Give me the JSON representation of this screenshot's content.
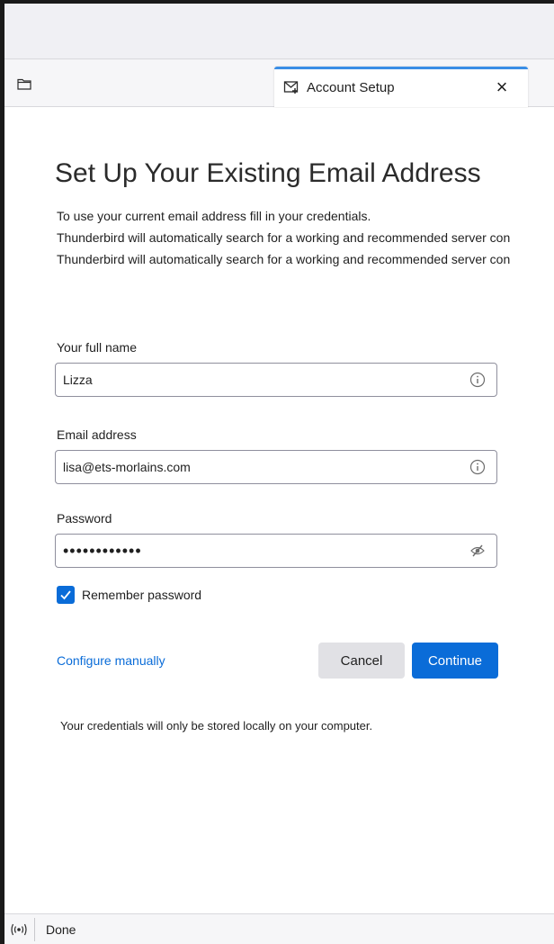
{
  "tab": {
    "label": "Account Setup",
    "close_symbol": "×"
  },
  "icons": {
    "folder": "folder-icon",
    "tab": "account-setup-icon",
    "info": "info-icon",
    "password_toggle": "eye-slash-icon",
    "check": "check-icon",
    "status": "online-status-icon"
  },
  "setup": {
    "heading": "Set Up Your Existing Email Address",
    "description": [
      "To use your current email address fill in your credentials.",
      "Thunderbird will automatically search for a working and recommended server con",
      "Thunderbird will automatically search for a working and recommended server con"
    ],
    "fields": {
      "full_name": {
        "label": "Your full name",
        "value": "Lizza"
      },
      "email": {
        "label": "Email address",
        "value": "lisa@ets-morlains.com"
      },
      "password": {
        "label": "Password",
        "value": "••••••••••••"
      }
    },
    "remember_password": {
      "label": "Remember password",
      "checked": true
    },
    "configure_manually": "Configure manually",
    "cancel_label": "Cancel",
    "continue_label": "Continue",
    "note": "Your credentials will only be stored locally on your computer."
  },
  "status": {
    "text": "Done"
  },
  "colors": {
    "accent": "#0a6cd8",
    "tab_indicator": "#3a8ee6",
    "chrome": "#f0f0f4"
  }
}
